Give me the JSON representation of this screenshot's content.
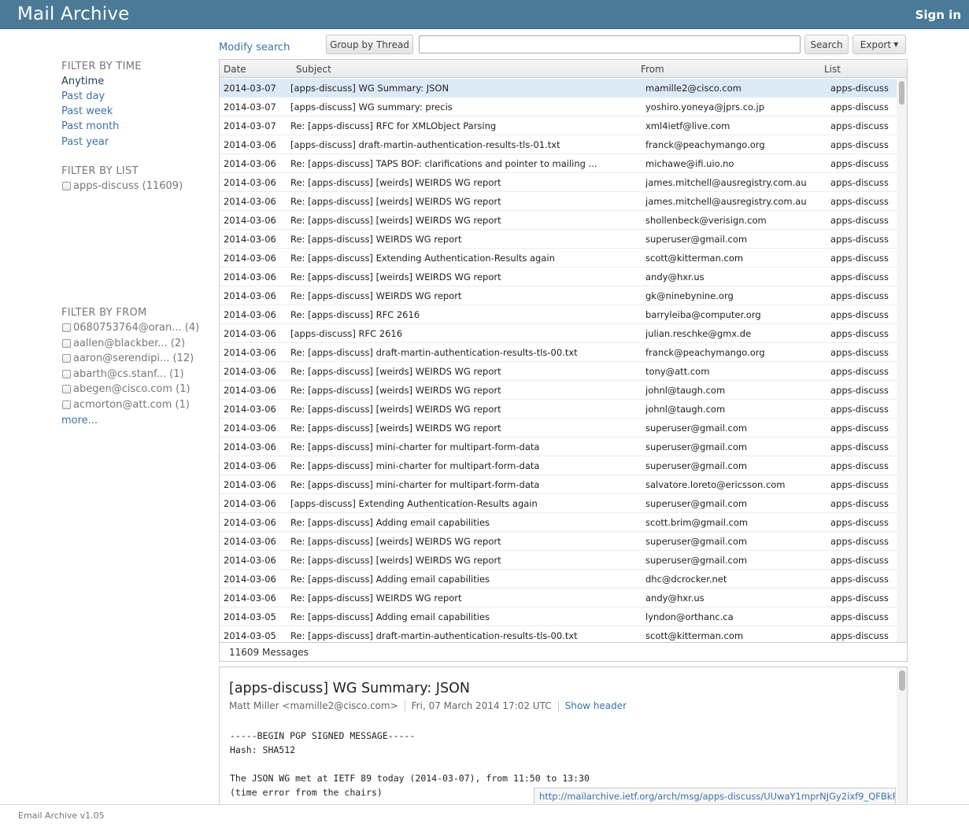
{
  "header": {
    "title": "Mail Archive",
    "signin": "Sign in"
  },
  "sidebar": {
    "time_heading": "FILTER BY TIME",
    "time_options": [
      "Anytime",
      "Past day",
      "Past week",
      "Past month",
      "Past year"
    ],
    "list_heading": "FILTER BY LIST",
    "lists": [
      "apps-discuss (11609)"
    ],
    "from_heading": "FILTER BY FROM",
    "froms": [
      "0680753764@oran... (4)",
      "aallen@blackber... (2)",
      "aaron@serendipi... (12)",
      "abarth@cs.stanf... (1)",
      "abegen@cisco.com (1)",
      "acmorton@att.com (1)"
    ],
    "more": "more..."
  },
  "toolbar": {
    "modify_search": "Modify search",
    "group_by_thread": "Group by Thread",
    "search_value": "",
    "search_button": "Search",
    "export_button": "Export"
  },
  "table": {
    "columns": {
      "date": "Date",
      "subject": "Subject",
      "from": "From",
      "list": "List"
    },
    "rows": [
      {
        "date": "2014-03-07",
        "subject": "[apps-discuss] WG Summary: JSON",
        "from": "mamille2@cisco.com",
        "list": "apps-discuss"
      },
      {
        "date": "2014-03-07",
        "subject": "[apps-discuss] WG summary: precis",
        "from": "yoshiro.yoneya@jprs.co.jp",
        "list": "apps-discuss"
      },
      {
        "date": "2014-03-07",
        "subject": "Re: [apps-discuss] RFC for XMLObject Parsing",
        "from": "xml4ietf@live.com",
        "list": "apps-discuss"
      },
      {
        "date": "2014-03-06",
        "subject": "[apps-discuss] draft-martin-authentication-results-tls-01.txt",
        "from": "franck@peachymango.org",
        "list": "apps-discuss"
      },
      {
        "date": "2014-03-06",
        "subject": "Re: [apps-discuss] TAPS BOF: clarifications and pointer to mailing ...",
        "from": "michawe@ifi.uio.no",
        "list": "apps-discuss"
      },
      {
        "date": "2014-03-06",
        "subject": "Re: [apps-discuss] [weirds] WEIRDS WG report",
        "from": "james.mitchell@ausregistry.com.au",
        "list": "apps-discuss"
      },
      {
        "date": "2014-03-06",
        "subject": "Re: [apps-discuss] [weirds] WEIRDS WG report",
        "from": "james.mitchell@ausregistry.com.au",
        "list": "apps-discuss"
      },
      {
        "date": "2014-03-06",
        "subject": "Re: [apps-discuss] [weirds] WEIRDS WG report",
        "from": "shollenbeck@verisign.com",
        "list": "apps-discuss"
      },
      {
        "date": "2014-03-06",
        "subject": "Re: [apps-discuss] WEIRDS WG report",
        "from": "superuser@gmail.com",
        "list": "apps-discuss"
      },
      {
        "date": "2014-03-06",
        "subject": "Re: [apps-discuss] Extending Authentication-Results again",
        "from": "scott@kitterman.com",
        "list": "apps-discuss"
      },
      {
        "date": "2014-03-06",
        "subject": "Re: [apps-discuss] [weirds] WEIRDS WG report",
        "from": "andy@hxr.us",
        "list": "apps-discuss"
      },
      {
        "date": "2014-03-06",
        "subject": "Re: [apps-discuss] WEIRDS WG report",
        "from": "gk@ninebynine.org",
        "list": "apps-discuss"
      },
      {
        "date": "2014-03-06",
        "subject": "Re: [apps-discuss] RFC 2616",
        "from": "barryleiba@computer.org",
        "list": "apps-discuss"
      },
      {
        "date": "2014-03-06",
        "subject": "[apps-discuss] RFC 2616",
        "from": "julian.reschke@gmx.de",
        "list": "apps-discuss"
      },
      {
        "date": "2014-03-06",
        "subject": "Re: [apps-discuss] draft-martin-authentication-results-tls-00.txt",
        "from": "franck@peachymango.org",
        "list": "apps-discuss"
      },
      {
        "date": "2014-03-06",
        "subject": "Re: [apps-discuss] [weirds] WEIRDS WG report",
        "from": "tony@att.com",
        "list": "apps-discuss"
      },
      {
        "date": "2014-03-06",
        "subject": "Re: [apps-discuss] [weirds] WEIRDS WG report",
        "from": "johnl@taugh.com",
        "list": "apps-discuss"
      },
      {
        "date": "2014-03-06",
        "subject": "Re: [apps-discuss] [weirds] WEIRDS WG report",
        "from": "johnl@taugh.com",
        "list": "apps-discuss"
      },
      {
        "date": "2014-03-06",
        "subject": "Re: [apps-discuss] [weirds] WEIRDS WG report",
        "from": "superuser@gmail.com",
        "list": "apps-discuss"
      },
      {
        "date": "2014-03-06",
        "subject": "Re: [apps-discuss] mini-charter for multipart-form-data",
        "from": "superuser@gmail.com",
        "list": "apps-discuss"
      },
      {
        "date": "2014-03-06",
        "subject": "Re: [apps-discuss] mini-charter for multipart-form-data",
        "from": "superuser@gmail.com",
        "list": "apps-discuss"
      },
      {
        "date": "2014-03-06",
        "subject": "Re: [apps-discuss] mini-charter for multipart-form-data",
        "from": "salvatore.loreto@ericsson.com",
        "list": "apps-discuss"
      },
      {
        "date": "2014-03-06",
        "subject": "[apps-discuss] Extending Authentication-Results again",
        "from": "superuser@gmail.com",
        "list": "apps-discuss"
      },
      {
        "date": "2014-03-06",
        "subject": "Re: [apps-discuss] Adding email capabilities",
        "from": "scott.brim@gmail.com",
        "list": "apps-discuss"
      },
      {
        "date": "2014-03-06",
        "subject": "Re: [apps-discuss] [weirds] WEIRDS WG report",
        "from": "superuser@gmail.com",
        "list": "apps-discuss"
      },
      {
        "date": "2014-03-06",
        "subject": "Re: [apps-discuss] [weirds] WEIRDS WG report",
        "from": "superuser@gmail.com",
        "list": "apps-discuss"
      },
      {
        "date": "2014-03-06",
        "subject": "Re: [apps-discuss] Adding email capabilities",
        "from": "dhc@dcrocker.net",
        "list": "apps-discuss"
      },
      {
        "date": "2014-03-06",
        "subject": "Re: [apps-discuss] WEIRDS WG report",
        "from": "andy@hxr.us",
        "list": "apps-discuss"
      },
      {
        "date": "2014-03-05",
        "subject": "Re: [apps-discuss] Adding email capabilities",
        "from": "lyndon@orthanc.ca",
        "list": "apps-discuss"
      },
      {
        "date": "2014-03-05",
        "subject": "Re: [apps-discuss] draft-martin-authentication-results-tls-00.txt",
        "from": "scott@kitterman.com",
        "list": "apps-discuss"
      }
    ],
    "message_count": "11609 Messages"
  },
  "viewer": {
    "subject": "[apps-discuss] WG Summary: JSON",
    "sender": "Matt Miller <mamille2@cisco.com>",
    "date": "Fri, 07 March 2014 17:02 UTC",
    "show_header": "Show header",
    "body_lines": [
      "-----BEGIN PGP SIGNED MESSAGE-----",
      "Hash: SHA512",
      "",
      "The JSON WG met at IETF 89 today (2014-03-07), from 11:50 to 13:30",
      "(time error from the chairs)"
    ],
    "url": "http://mailarchive.ietf.org/arch/msg/apps-discuss/UUwaY1mprNJGy2ixf9_QFBkRWI8"
  },
  "footer": {
    "version": "Email Archive v1.05"
  }
}
